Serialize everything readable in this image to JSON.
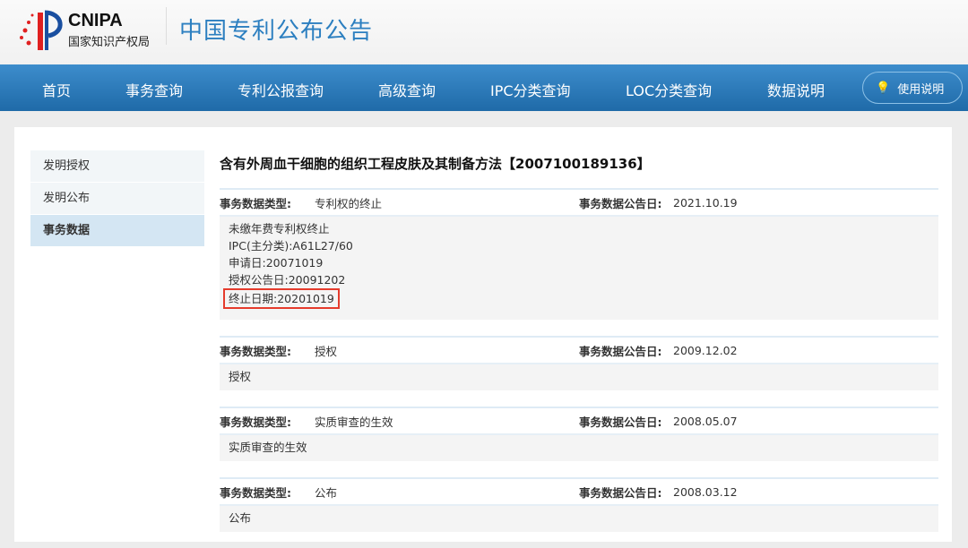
{
  "header": {
    "logo_en": "CNIPA",
    "logo_zh": "国家知识产权局",
    "site_title": "中国专利公布公告"
  },
  "nav": {
    "items": [
      "首页",
      "事务查询",
      "专利公报查询",
      "高级查询",
      "IPC分类查询",
      "LOC分类查询",
      "数据说明"
    ],
    "help": "使用说明"
  },
  "sidebar": {
    "items": [
      "发明授权",
      "发明公布",
      "事务数据"
    ],
    "active": 2
  },
  "main": {
    "title": "含有外周血干细胞的组织工程皮肤及其制备方法【2007100189136】",
    "type_label": "事务数据类型:",
    "date_label": "事务数据公告日:",
    "records": [
      {
        "type": "专利权的终止",
        "date": "2021.10.19",
        "lines": [
          "未缴年费专利权终止",
          "IPC(主分类):A61L27/60",
          "申请日:20071019",
          "授权公告日:20091202"
        ],
        "highlight": "终止日期:20201019"
      },
      {
        "type": "授权",
        "date": "2009.12.02",
        "lines": [
          "授权"
        ]
      },
      {
        "type": "实质审查的生效",
        "date": "2008.05.07",
        "lines": [
          "实质审查的生效"
        ]
      },
      {
        "type": "公布",
        "date": "2008.03.12",
        "lines": [
          "公布"
        ]
      }
    ]
  },
  "colors": {
    "nav": "#2a78b8",
    "title": "#2c7fc0",
    "highlight": "#e53b2c"
  }
}
